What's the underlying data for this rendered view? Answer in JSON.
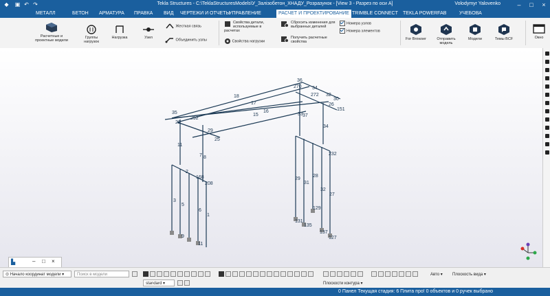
{
  "titlebar": {
    "title": "Tekla Structures - C:\\TeklaStructuresModels\\У_Залізобетон_ХНАДУ_Розразунок - [View 3 - Разрез по оси А]",
    "user": "Volodymyr Yalovenko"
  },
  "menu": {
    "items": [
      "МЕТАЛЛ",
      "БЕТОН",
      "АРМАТУРА",
      "ПРАВКА",
      "ВИД",
      "ЧЕРТЕЖИ И ОТЧЕТЫ",
      "УПРАВЛЕНИЕ",
      "РАСЧЕТ И ПРОЕКТИРОВАНИЕ",
      "TRIMBLE CONNECT",
      "TEKLA POWERFAB",
      "УЧЕБОВА"
    ],
    "active_index": 7,
    "search_placeholder": "Быстрый запуск"
  },
  "ribbon": {
    "analysis_models": "Расчетные и проектные модели",
    "load_groups": "Группы нагрузок",
    "loads": "Нагрузка",
    "node": "Узел",
    "rigid_link": "Жесткая связь",
    "merge_nodes": "Объединить узлы",
    "part_props": "Свойства детали, используемые в расчетах",
    "load_props": "Свойства нагрузки",
    "reset_changes": "Сбросить изменения для выбранных деталей",
    "get_props": "Получить расчетные свойства",
    "node_numbers": "Номера узлов",
    "element_numbers": "Номера элементов",
    "for_browser": "For Browser",
    "send_model": "Отправить модель",
    "models": "Модели",
    "bcf_topics": "Темы BCF",
    "window": "Окно"
  },
  "model_labels": {
    "beam_18": "18",
    "beam_17": "17",
    "beam_16": "16",
    "beam_15": "15",
    "n36": "36",
    "n34": "34",
    "n32": "32",
    "n30": "30",
    "n151": "151",
    "n35": "35",
    "n292": "292",
    "n29": "29",
    "n25": "25",
    "n11": "11",
    "n7": "7",
    "n8": "8",
    "n33": "33",
    "n37": "37",
    "n3334": "34",
    "n2": "2",
    "n168": "168",
    "n208": "208",
    "n3": "3",
    "n6": "6",
    "n1": "1",
    "n5": "5",
    "n9": "9",
    "n111": "11",
    "n232": "232",
    "n31": "31",
    "n28": "28",
    "n27": "27",
    "n129": "129",
    "n131": "131",
    "n135": "135",
    "n137": "137",
    "n127": "127",
    "n270": "270",
    "n272": "272",
    "n26": "26",
    "n22": "22"
  },
  "status": {
    "coord_origin": "Начало координат модели",
    "search_model_placeholder": "Поиск в модели",
    "standard": "standard",
    "auto": "Авто",
    "view_plane": "Плоскость вида",
    "contour_plane": "Плоскости контура",
    "prompt": "0 Панел Текущая стадия: 6 Плита про! 0 объектов и 0 ручек выбрано"
  }
}
